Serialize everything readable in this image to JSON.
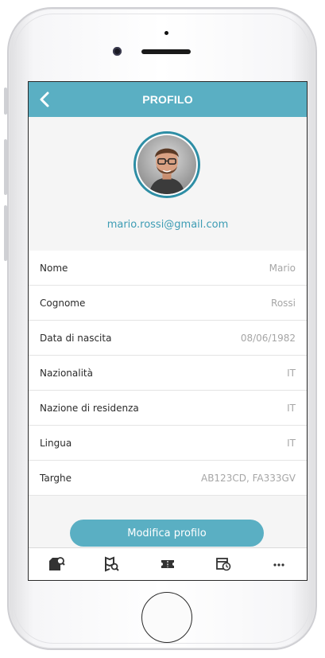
{
  "header": {
    "title": "PROFILO",
    "back_icon": "chevron-left-icon"
  },
  "profile": {
    "email": "mario.rossi@gmail.com"
  },
  "fields": [
    {
      "label": "Nome",
      "value": "Mario"
    },
    {
      "label": "Cognome",
      "value": "Rossi"
    },
    {
      "label": "Data di nascita",
      "value": "08/06/1982"
    },
    {
      "label": "Nazionalità",
      "value": "IT"
    },
    {
      "label": "Nazione di residenza",
      "value": "IT"
    },
    {
      "label": "Lingua",
      "value": "IT"
    },
    {
      "label": "Targhe",
      "value": "AB123CD, FA333GV"
    }
  ],
  "edit_button": {
    "label": "Modifica profilo"
  },
  "tabbar": [
    {
      "icon": "parking-search-icon"
    },
    {
      "icon": "map-search-icon"
    },
    {
      "icon": "ticket-icon"
    },
    {
      "icon": "calendar-clock-icon"
    },
    {
      "icon": "more-icon"
    }
  ],
  "colors": {
    "accent": "#5aafc3",
    "email": "#3d9cb4",
    "avatar_border": "#2e8ea5"
  }
}
